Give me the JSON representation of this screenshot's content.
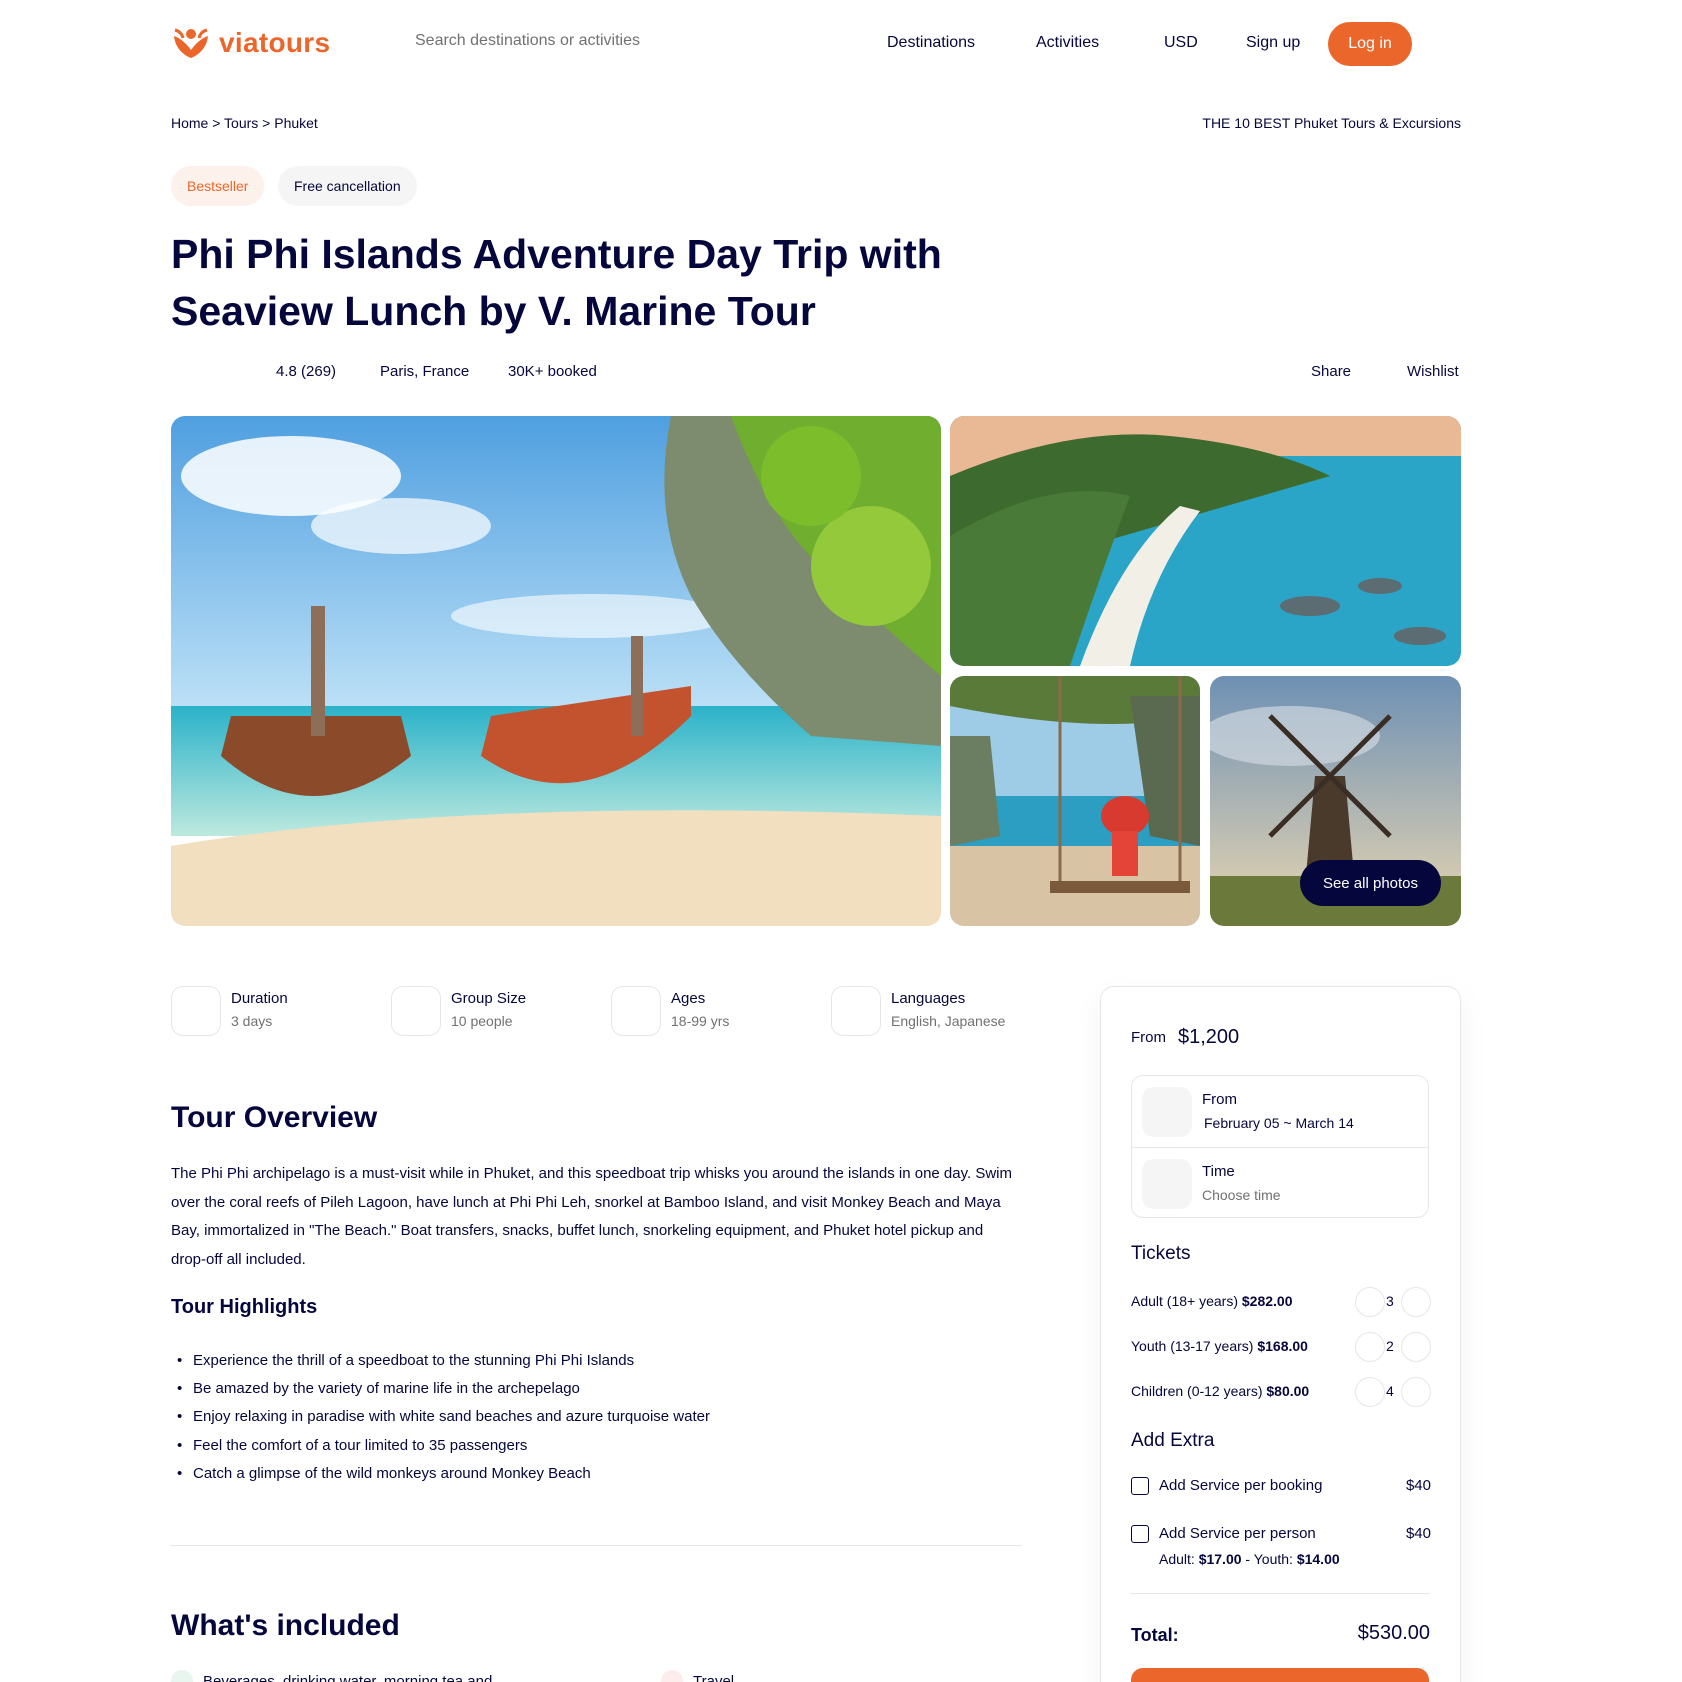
{
  "brand": {
    "name": "viatours",
    "accent": "#eb662b",
    "navy": "#05073c"
  },
  "search": {
    "placeholder": "Search destinations or activities"
  },
  "nav": {
    "destinations": "Destinations",
    "activities": "Activities",
    "currency": "USD",
    "signup": "Sign up",
    "login": "Log in"
  },
  "breadcrumb": {
    "text": "Home > Tours > Phuket",
    "right": "THE 10 BEST Phuket Tours & Excursions"
  },
  "badges": {
    "bestseller": "Bestseller",
    "cancellation": "Free cancellation"
  },
  "tour": {
    "title": "Phi Phi Islands Adventure Day Trip with Seaview Lunch by V. Marine Tour",
    "rating": "4.8 (269)",
    "location": "Paris, France",
    "booked": "30K+ booked",
    "share": "Share",
    "wishlist": "Wishlist"
  },
  "gallery": {
    "see_all": "See all photos"
  },
  "info": [
    {
      "label": "Duration",
      "value": "3 days",
      "icon": "clock-icon"
    },
    {
      "label": "Group Size",
      "value": "10 people",
      "icon": "users-icon"
    },
    {
      "label": "Ages",
      "value": "18-99 yrs",
      "icon": "age-icon"
    },
    {
      "label": "Languages",
      "value": "English, Japanese",
      "icon": "globe-icon"
    }
  ],
  "overview": {
    "heading": "Tour Overview",
    "text": "The Phi Phi archipelago is a must-visit while in Phuket, and this speedboat trip whisks you around the islands in one day. Swim over the coral reefs of Pileh Lagoon, have lunch at Phi Phi Leh, snorkel at Bamboo Island, and visit Monkey Beach and Maya Bay, immortalized in \"The Beach.\" Boat transfers, snacks, buffet lunch, snorkeling equipment, and Phuket hotel pickup and drop-off all included.",
    "highlights_heading": "Tour Highlights",
    "highlights": [
      "Experience the thrill of a speedboat to the stunning Phi Phi Islands",
      "Be amazed by the variety of marine life in the archepelago",
      "Enjoy relaxing in paradise with white sand beaches and azure turquoise water",
      "Feel the comfort of a tour limited to 35 passengers",
      "Catch a glimpse of the wild monkeys around Monkey Beach"
    ]
  },
  "included": {
    "heading": "What's included",
    "items": [
      "Beverages, drinking water, morning tea and",
      "Travel"
    ]
  },
  "booking": {
    "from_label": "From",
    "price": "$1,200",
    "date_label": "From",
    "date_value": "February 05 ~ March 14",
    "time_label": "Time",
    "time_value": "Choose time",
    "tickets_heading": "Tickets",
    "tickets": [
      {
        "label": "Adult (18+ years)",
        "price": "$282.00",
        "qty": "3"
      },
      {
        "label": "Youth (13-17 years)",
        "price": "$168.00",
        "qty": "2"
      },
      {
        "label": "Children (0-12 years)",
        "price": "$80.00",
        "qty": "4"
      }
    ],
    "extra_heading": "Add Extra",
    "extras": [
      {
        "label": "Add Service per booking",
        "price": "$40"
      },
      {
        "label": "Add Service per person",
        "price": "$40"
      }
    ],
    "extra_sub": {
      "adult_label": "Adult:",
      "adult_price": "$17.00",
      "sep": "-",
      "youth_label": "Youth:",
      "youth_price": "$14.00"
    },
    "total_label": "Total:",
    "total_value": "$530.00"
  }
}
